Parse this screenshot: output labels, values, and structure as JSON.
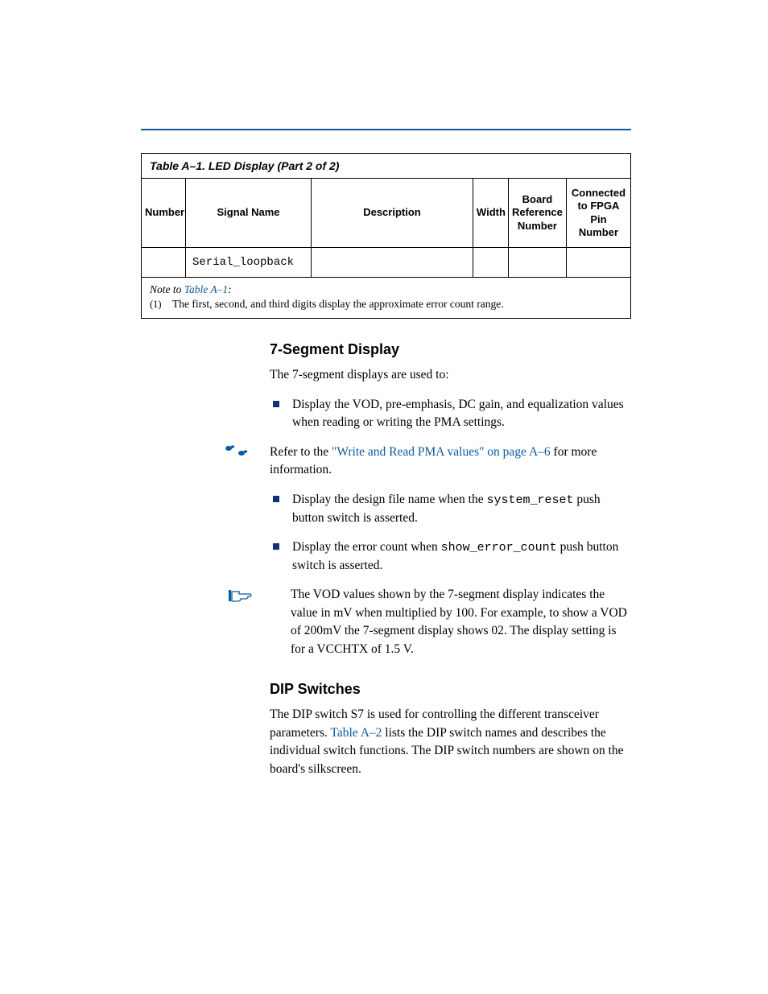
{
  "table": {
    "caption": "Table A–1. LED Display  (Part 2 of 2)",
    "headers": {
      "number": "Number",
      "signal": "Signal Name",
      "desc": "Description",
      "width": "Width",
      "board": "Board Reference Number",
      "fpga": "Connected to FPGA Pin Number"
    },
    "row": {
      "signal": "Serial_loopback"
    },
    "note": {
      "prefix": "Note to ",
      "ref": "Table A–1",
      "suffix": ":",
      "num": "(1)",
      "text": "The first, second, and third digits display the approximate error count range."
    }
  },
  "sections": {
    "seg7": {
      "title": "7-Segment Display",
      "intro": "The 7-segment displays are used to:",
      "bullet1": "Display the VOD, pre-emphasis, DC gain, and equalization values when reading or writing the PMA settings.",
      "ref_pre": "Refer to the ",
      "ref_link": "\"Write and Read PMA values\" on page A–6",
      "ref_post": " for more information.",
      "bullet2_a": "Display the design file name when the ",
      "bullet2_code": "system_reset",
      "bullet2_b": " push button switch is asserted.",
      "bullet3_a": "Display the error count when ",
      "bullet3_code": "show_error_count",
      "bullet3_b": " push button switch is asserted.",
      "note": "The VOD values shown by the 7-segment display indicates the value in mV when multiplied by 100. For example, to show a VOD of 200mV the 7-segment display shows 02. The display setting is for a VCCHTX of 1.5 V."
    },
    "dip": {
      "title": "DIP Switches",
      "p1a": "The DIP switch S7 is used for controlling the different transceiver parameters. ",
      "p1_link": "Table A–2",
      "p1b": " lists the DIP switch names and describes the individual switch functions. The DIP switch numbers are shown on the board's silkscreen."
    }
  }
}
